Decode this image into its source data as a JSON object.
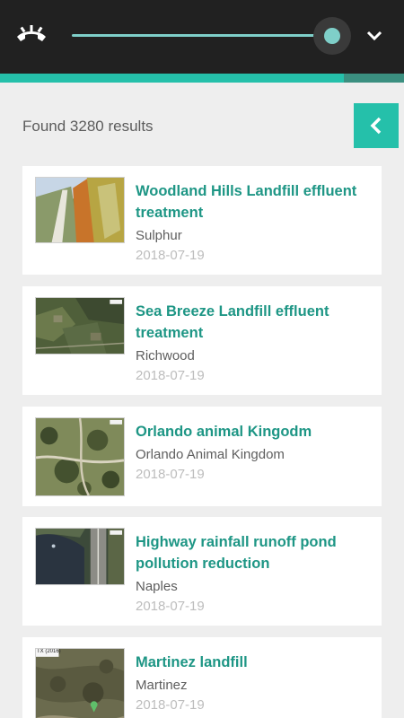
{
  "header": {
    "hangup_icon": "phone-hangup-icon",
    "dropdown_icon": "chevron-down-icon",
    "slider_value": 0.99,
    "progress_value": 0.85
  },
  "results": {
    "count_text": "Found 3280 results",
    "back_icon": "chevron-left-icon"
  },
  "items": [
    {
      "title": "Woodland Hills Landfill effluent treatment",
      "subtitle": "Sulphur",
      "date": "2018-07-19"
    },
    {
      "title": "Sea Breeze Landfill effluent treatment",
      "subtitle": "Richwood",
      "date": "2018-07-19"
    },
    {
      "title": "Orlando animal Kingodm",
      "subtitle": "Orlando Animal Kingdom",
      "date": "2018-07-19"
    },
    {
      "title": "Highway rainfall runoff pond pollution reduction",
      "subtitle": "Naples",
      "date": "2018-07-19"
    },
    {
      "title": "Martinez landfill",
      "subtitle": "Martinez",
      "date": "2018-07-19",
      "thumb_label": "TX (2016)"
    }
  ],
  "colors": {
    "accent": "#25c0aa",
    "title": "#1e9685",
    "topbar": "#212121",
    "slider": "#7fcfc9"
  }
}
